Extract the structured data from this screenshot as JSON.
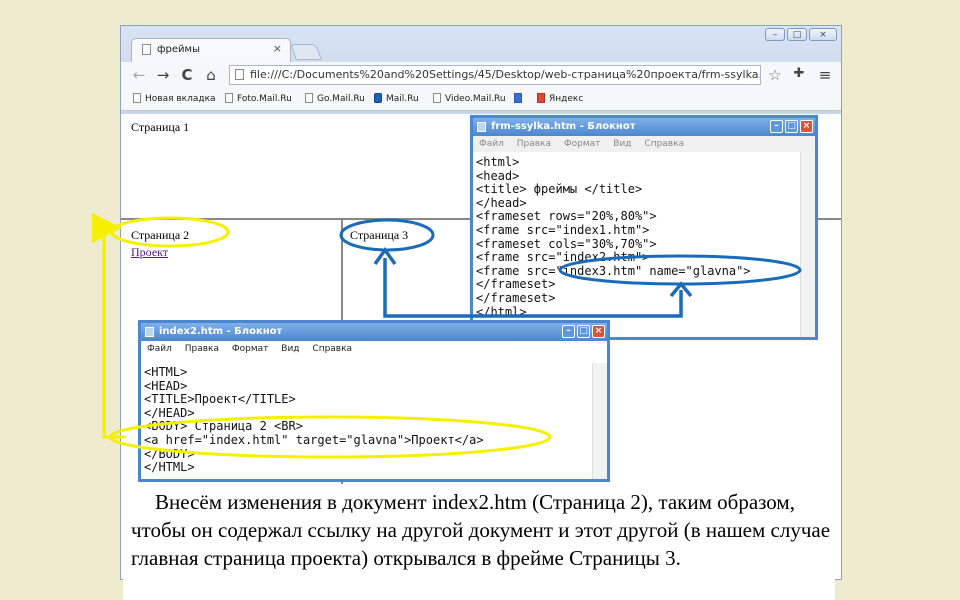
{
  "browser": {
    "tab_title": "фреймы",
    "tab_close": "×",
    "window_buttons": [
      "–",
      "□",
      "×"
    ],
    "nav": {
      "back": "←",
      "forward": "→",
      "reload": "C",
      "home": "⌂"
    },
    "url": "file:///C:/Documents%20and%20Settings/45/Desktop/web-страница%20проекта/frm-ssylka.htm",
    "toolbar_icons": {
      "star": "☆",
      "extension": "✚",
      "menu": "≡"
    },
    "bookmarks": [
      "Новая вкладка",
      "Foto.Mail.Ru",
      "Go.Mail.Ru",
      "Mail.Ru",
      "Video.Mail.Ru",
      "Яндекс"
    ]
  },
  "frames": {
    "frame1_text": "Страница 1",
    "frame2_text": "Страница 2",
    "frame2_link": "Проект",
    "frame3_text": "Страница 3"
  },
  "notepad1": {
    "title": "frm-ssylka.htm - Блокнот",
    "menu": [
      "Файл",
      "Правка",
      "Формат",
      "Вид",
      "Справка"
    ],
    "code": "<html>\n<head>\n<title> фреймы </title>\n</head>\n<frameset rows=\"20%,80%\">\n<frame src=\"index1.htm\">\n<frameset cols=\"30%,70%\">\n<frame src=\"index2.htm\">\n<frame src=\"index3.htm\" name=\"glavna\">\n</frameset>\n</frameset>\n</html>"
  },
  "notepad2": {
    "title": "index2.htm - Блокнот",
    "menu": [
      "Файл",
      "Правка",
      "Формат",
      "Вид",
      "Справка"
    ],
    "code": "<HTML>\n<HEAD>\n<TITLE>Проект</TITLE>\n</HEAD>\n<BODY> Страница 2 <BR>\n<a href=\"index.html\" target=\"glavna\">Проект</a>\n</BODY>\n</HTML>"
  },
  "caption": "Внесём изменения в документ index2.htm (Страница 2), таким образом, чтобы он содержал ссылку на другой документ и этот другой (в нашем случае главная страница проекта) открывался в фрейме Страницы 3.",
  "colors": {
    "highlight_yellow": "#f4f000",
    "highlight_blue": "#1a6bb8",
    "notepad_border": "#4b87cf"
  }
}
